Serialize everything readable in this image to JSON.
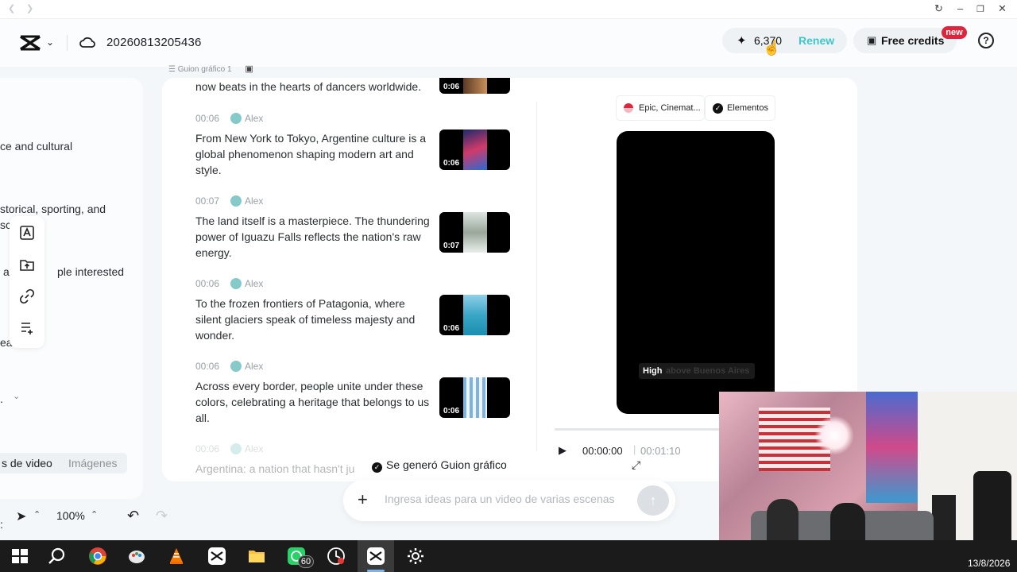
{
  "app": {
    "project_name": "20260813205436",
    "credits": "6,370",
    "renew_label": "Renew",
    "free_credits_label": "Free credits",
    "new_badge": "new",
    "help_glyph": "?"
  },
  "storyboard_tag": "Guion gráfico 1",
  "left_panel": {
    "lines": [
      "ce and cultural",
      "storical, sporting, and",
      "sc",
      "a",
      "ple interested",
      "eal",
      "."
    ],
    "tabs": [
      "s de video",
      "Imágenes"
    ]
  },
  "scenes": [
    {
      "time": "",
      "speaker": "",
      "text": "now beats in the hearts of dancers worldwide.",
      "duration": "0:06"
    },
    {
      "time": "00:06",
      "speaker": "Alex",
      "text": "From New York to Tokyo, Argentine culture is a global phenomenon shaping modern art and style.",
      "duration": "0:06"
    },
    {
      "time": "00:07",
      "speaker": "Alex",
      "text": "The land itself is a masterpiece. The thundering power of Iguazu Falls reflects the nation's raw energy.",
      "duration": "0:07"
    },
    {
      "time": "00:06",
      "speaker": "Alex",
      "text": "To the frozen frontiers of Patagonia, where silent glaciers speak of timeless majesty and wonder.",
      "duration": "0:06"
    },
    {
      "time": "00:06",
      "speaker": "Alex",
      "text": "Across every border, people unite under these colors, celebrating a heritage that belongs to us all.",
      "duration": "0:06"
    },
    {
      "time": "00:06",
      "speaker": "Alex",
      "text": "Argentina: a nation that hasn't ju",
      "duration": ""
    }
  ],
  "preview": {
    "style_chip": "Epic, Cinemat...",
    "elements_chip": "Elementos",
    "subtitle_bold": "High",
    "subtitle_rest": "above Buenos Aires",
    "current_time": "00:00:00",
    "total_time": "00:01:10"
  },
  "status_text": "Se generó Guion gráfico",
  "prompt": {
    "placeholder": "Ingresa ideas para un video de varias escenas"
  },
  "toolbar": {
    "zoom": "100%"
  },
  "taskbar": {
    "whatsapp_badge": "60",
    "date": "13/8/2026"
  },
  "colors": {
    "accent": "#3ec6c9",
    "badge": "#e0243b"
  }
}
